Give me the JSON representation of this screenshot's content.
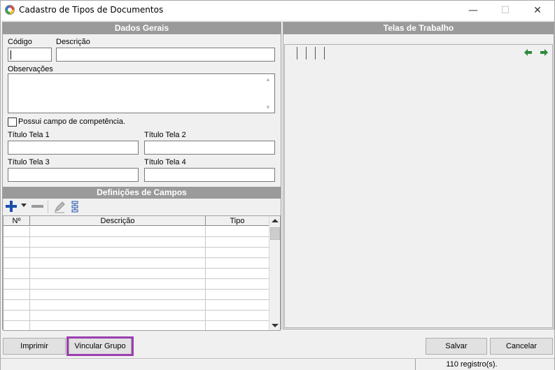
{
  "window": {
    "title": "Cadastro de Tipos de Documentos",
    "min_glyph": "—",
    "max_glyph": "☐",
    "close_glyph": "✕"
  },
  "dados_gerais": {
    "header": "Dados Gerais",
    "codigo_label": "Código",
    "codigo_value": "",
    "descricao_label": "Descrição",
    "descricao_value": "",
    "observacoes_label": "Observações",
    "observacoes_value": "",
    "competencia_label": "Possui campo de competência.",
    "competencia_checked": false,
    "titulo_tela1_label": "Título Tela 1",
    "titulo_tela2_label": "Título Tela 2",
    "titulo_tela3_label": "Título Tela 3",
    "titulo_tela4_label": "Título Tela 4"
  },
  "definicoes": {
    "header": "Definições de Campos",
    "columns": [
      "Nº",
      "Descrição",
      "Tipo"
    ],
    "rows": []
  },
  "telas": {
    "header": "Telas de Trabalho"
  },
  "buttons": {
    "imprimir": "Imprimir",
    "vincular_grupo": "Vincular Grupo",
    "salvar": "Salvar",
    "cancelar": "Cancelar"
  },
  "status": {
    "records": "110 registro(s)."
  },
  "colors": {
    "header_bg": "#9a9a9a",
    "highlight": "#9b3fb0",
    "plus_icon": "#1c4fae",
    "nav_arrow": "#2c8a3c"
  }
}
